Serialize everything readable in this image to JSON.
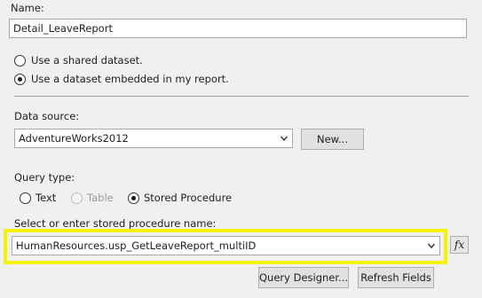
{
  "name_section": {
    "label": "Name:",
    "value": "Detail_LeaveReport"
  },
  "dataset_options": {
    "shared_label": "Use a shared dataset.",
    "embedded_label": "Use a dataset embedded in my report.",
    "selected": "embedded"
  },
  "data_source": {
    "label": "Data source:",
    "selected_value": "AdventureWorks2012",
    "new_button_label": "New..."
  },
  "query_type": {
    "label": "Query type:",
    "options": [
      {
        "label": "Text",
        "enabled": true,
        "checked": false
      },
      {
        "label": "Table",
        "enabled": false,
        "checked": false
      },
      {
        "label": "Stored Procedure",
        "enabled": true,
        "checked": true
      }
    ]
  },
  "stored_procedure": {
    "label": "Select or enter stored procedure name:",
    "selected_value": "HumanResources.usp_GetLeaveReport_multiID",
    "expression_button_label": "fx",
    "highlight_color": "#f4f400"
  },
  "actions": {
    "query_designer_label": "Query Designer...",
    "refresh_fields_label": "Refresh Fields"
  },
  "icons": [
    "radio-button-icon",
    "dropdown-arrow-icon",
    "expression-fx-icon"
  ]
}
